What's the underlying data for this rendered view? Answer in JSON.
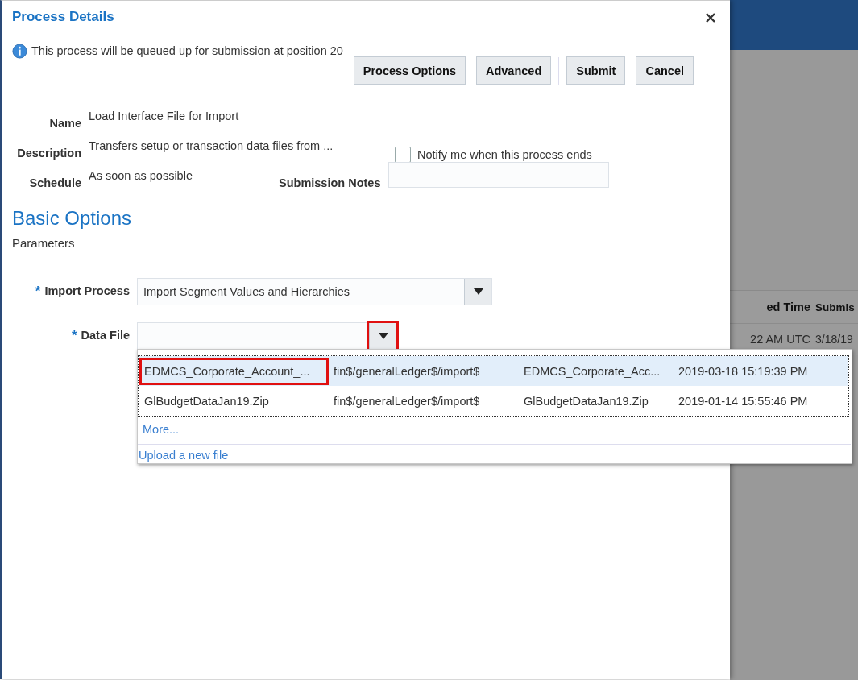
{
  "dialog": {
    "title": "Process Details",
    "info": "This process will be queued up for submission at position 20",
    "buttons": [
      {
        "label": "Process Options",
        "separator_after": false
      },
      {
        "label": "Advanced",
        "separator_after": true
      },
      {
        "label": "Sub**m**it",
        "separator_after": false
      },
      {
        "label": "**C**ancel",
        "separator_after": false
      }
    ],
    "fields": [
      {
        "label": "Name",
        "value": "Load Interface File for Import"
      },
      {
        "label": "Description",
        "value": "Transfers setup or transaction data files from ..."
      },
      {
        "label": "Schedule",
        "value": "As soon as possible"
      }
    ],
    "notify": {
      "label": "Notify me when this process ends",
      "checked": false
    },
    "submission_notes": {
      "label": "Submission Notes"
    },
    "section_title": "Basic Options",
    "subsection": "Parameters",
    "import_process": {
      "label": "Import Process",
      "required_mark": "*",
      "value": "Import Segment Values and Hierarchies"
    },
    "data_file": {
      "label": "Data File",
      "required_mark": "*",
      "button_highlighted": true,
      "rows": [
        {
          "name": "EDMCS_Corporate_Account_...",
          "path": "fin$/generalLedger$/import$",
          "file": "EDMCS_Corporate_Acc...",
          "date": "2019-03-18 15:19:39 PM",
          "selected": true,
          "highlighted": true
        },
        {
          "name": "GlBudgetDataJan19.Zip",
          "path": "fin$/generalLedger$/import$",
          "file": "GlBudgetDataJan19.Zip",
          "date": "2019-01-14 15:55:46 PM",
          "selected": false,
          "highlighted": false
        }
      ],
      "more": "More...",
      "upload": "Upload a new file"
    }
  },
  "background_table": {
    "columns": [
      "ed Time",
      "Submis"
    ],
    "rows": [
      [
        "22 AM UTC",
        "3/18/19"
      ]
    ]
  }
}
